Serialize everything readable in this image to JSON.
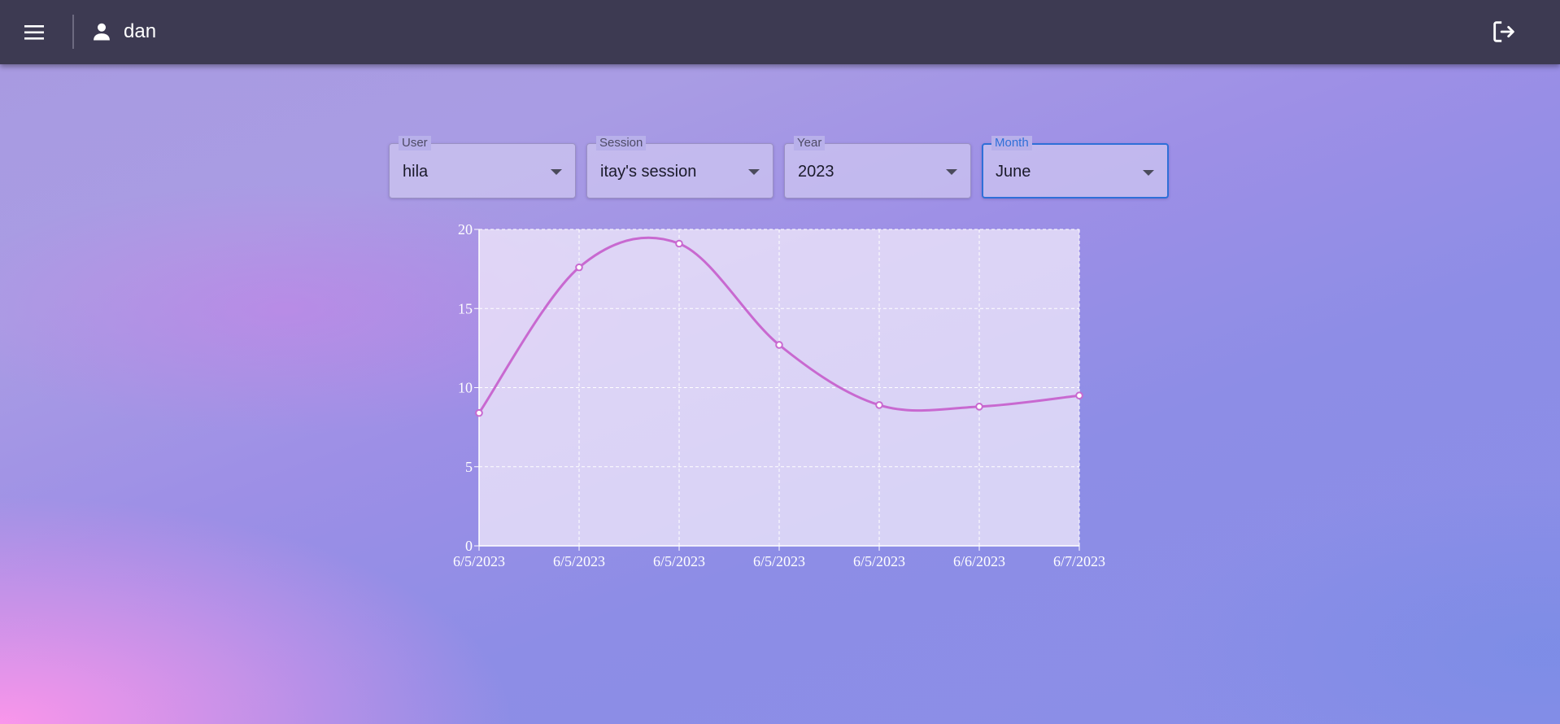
{
  "header": {
    "username": "dan",
    "icons": {
      "menu": "menu-icon",
      "user": "person-icon",
      "logout": "logout-icon"
    }
  },
  "filters": {
    "user": {
      "label": "User",
      "value": "hila"
    },
    "session": {
      "label": "Session",
      "value": "itay's session"
    },
    "year": {
      "label": "Year",
      "value": "2023"
    },
    "month": {
      "label": "Month",
      "value": "June",
      "focused": true
    }
  },
  "colors": {
    "appbar": "#3d3a52",
    "accent": "#2f6fd8",
    "series": "#c869d0"
  },
  "chart_data": {
    "type": "line",
    "x": [
      "6/5/2023",
      "6/5/2023",
      "6/5/2023",
      "6/5/2023",
      "6/5/2023",
      "6/6/2023",
      "6/7/2023"
    ],
    "series": [
      {
        "values": [
          8.4,
          17.6,
          19.1,
          12.7,
          8.9,
          8.8,
          9.5
        ]
      }
    ],
    "yticks": [
      0,
      5,
      10,
      15,
      20
    ],
    "ylim": [
      0,
      20
    ],
    "grid": true,
    "smooth": true,
    "title": "",
    "xlabel": "",
    "ylabel": ""
  }
}
